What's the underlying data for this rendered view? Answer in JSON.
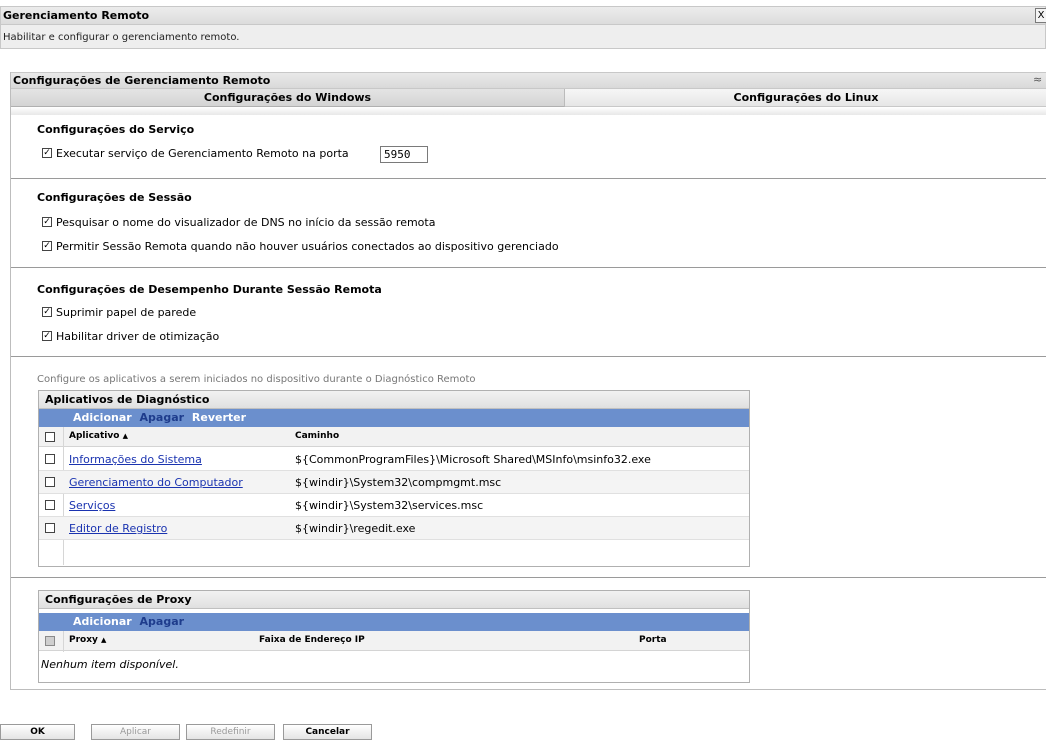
{
  "header": {
    "title": "Gerenciamento Remoto",
    "subtitle": "Habilitar e configurar o gerenciamento remoto.",
    "close_glyph": "X"
  },
  "panel": {
    "title": "Configurações de Gerenciamento Remoto",
    "collapse_glyph": "≈",
    "tabs": [
      {
        "label": "Configurações do Windows",
        "active": true
      },
      {
        "label": "Configurações do Linux",
        "active": false
      }
    ]
  },
  "service": {
    "title": "Configurações do Serviço",
    "run_service_label": "Executar serviço de Gerenciamento Remoto na porta",
    "run_service_checked": true,
    "port_value": "5950"
  },
  "session": {
    "title": "Configurações de Sessão",
    "dns_lookup_label": "Pesquisar o nome do visualizador de DNS no início da sessão remota",
    "dns_lookup_checked": true,
    "allow_no_user_label": "Permitir Sessão Remota quando não houver usuários conectados ao dispositivo gerenciado",
    "allow_no_user_checked": true
  },
  "performance": {
    "title": "Configurações de Desempenho Durante Sessão Remota",
    "suppress_wallpaper_label": "Suprimir papel de parede",
    "suppress_wallpaper_checked": true,
    "optimization_driver_label": "Habilitar driver de otimização",
    "optimization_driver_checked": true
  },
  "diagnostic": {
    "hint": "Configure os aplicativos a serem iniciados no dispositivo durante o Diagnóstico Remoto",
    "table_title": "Aplicativos de Diagnóstico",
    "toolbar": {
      "add": "Adicionar",
      "delete": "Apagar",
      "revert": "Reverter"
    },
    "columns": {
      "app": "Aplicativo",
      "path": "Caminho"
    },
    "sort_glyph": "▲",
    "rows": [
      {
        "app": "Informações do Sistema",
        "path": "${CommonProgramFiles}\\Microsoft Shared\\MSInfo\\msinfo32.exe"
      },
      {
        "app": "Gerenciamento do Computador",
        "path": "${windir}\\System32\\compmgmt.msc"
      },
      {
        "app": "Serviços",
        "path": "${windir}\\System32\\services.msc"
      },
      {
        "app": "Editor de Registro",
        "path": "${windir}\\regedit.exe"
      }
    ]
  },
  "proxy": {
    "table_title": "Configurações de Proxy",
    "toolbar": {
      "add": "Adicionar",
      "delete": "Apagar"
    },
    "columns": {
      "proxy": "Proxy",
      "range": "Faixa de Endereço IP",
      "port": "Porta"
    },
    "sort_glyph": "▲",
    "empty_text": "Nenhum item disponível."
  },
  "buttons": {
    "ok": "OK",
    "apply": "Aplicar",
    "reset": "Redefinir",
    "cancel": "Cancelar"
  },
  "check_glyph": "✓"
}
